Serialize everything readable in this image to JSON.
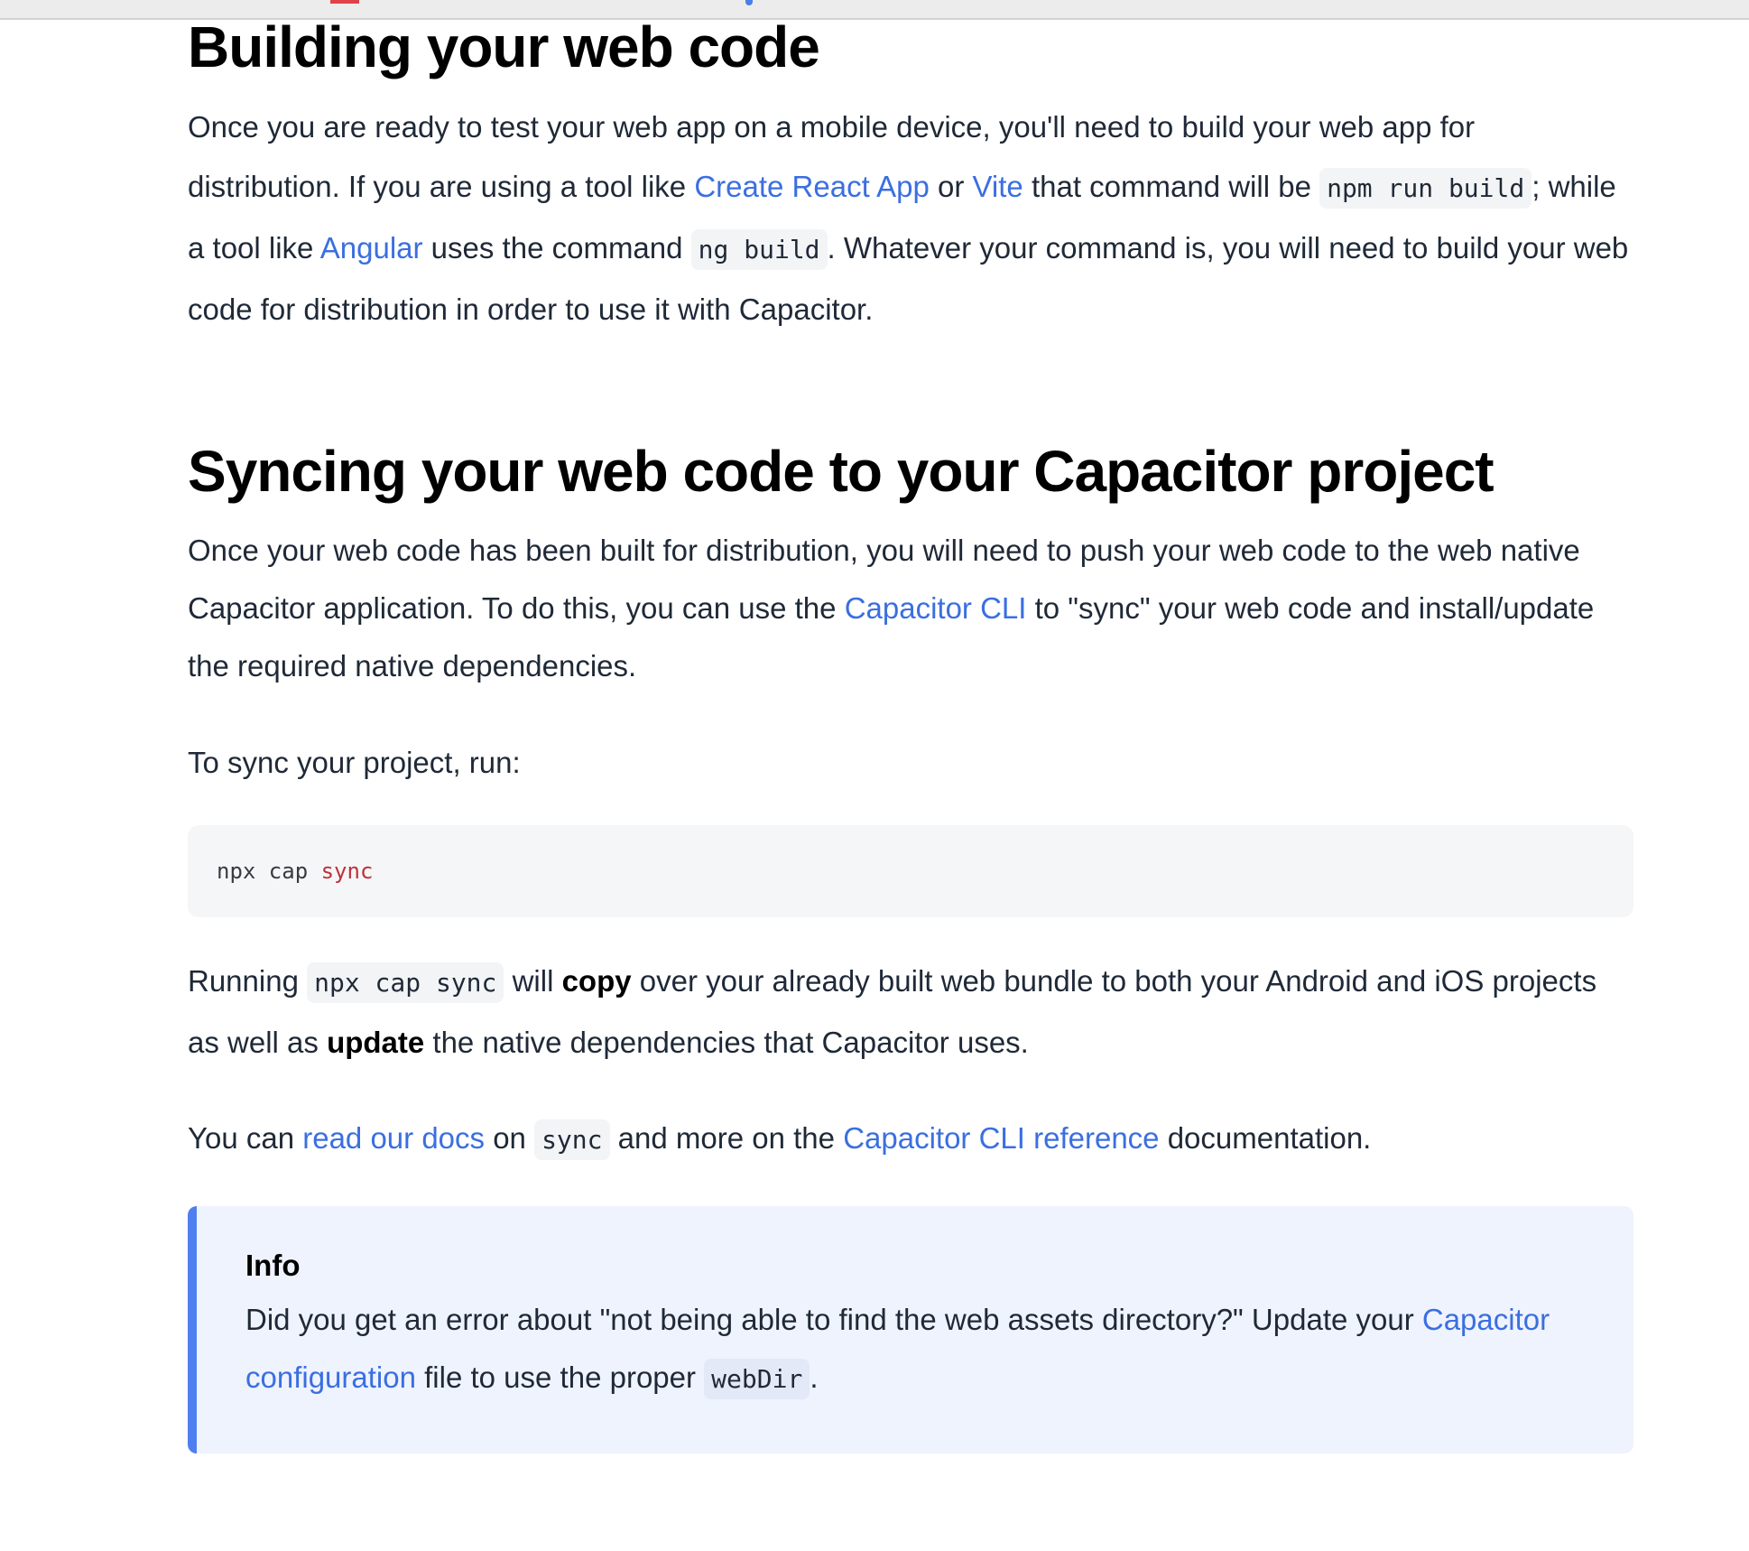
{
  "sections": {
    "building": {
      "heading": "Building your web code",
      "text_1": "Once you are ready to test your web app on a mobile device, you'll need to build your web app for distribution. If you are using a tool like ",
      "link_create_react_app": "Create React App",
      "text_2": " or ",
      "link_vite": "Vite",
      "text_3": " that command will be ",
      "code_npm_run_build": "npm run build",
      "text_4": "; while a tool like ",
      "link_angular": "Angular",
      "text_5": " uses the command ",
      "code_ng_build": "ng build",
      "text_6": ". Whatever your command is, you will need to build your web code for distribution in order to use it with Capacitor."
    },
    "syncing": {
      "heading": "Syncing your web code to your Capacitor project",
      "text_1": "Once your web code has been built for distribution, you will need to push your web code to the web native Capacitor application. To do this, you can use the ",
      "link_capacitor_cli": "Capacitor CLI",
      "text_2": " to \"sync\" your web code and install/update the required native dependencies.",
      "to_run": "To sync your project, run:",
      "code_block": {
        "part_1": "npx cap ",
        "keyword": "sync"
      },
      "running": {
        "text_1": "Running ",
        "code": "npx cap sync",
        "text_2": " will ",
        "bold_copy": "copy",
        "text_3": " over your already built web bundle to both your Android and iOS projects as well as ",
        "bold_update": "update",
        "text_4": " the native dependencies that Capacitor uses."
      },
      "you_can": {
        "text_1": "You can ",
        "link_read_docs": "read our docs",
        "text_2": " on ",
        "code_sync": "sync",
        "text_3": " and more on the ",
        "link_cli_reference": "Capacitor CLI reference",
        "text_4": " documentation."
      }
    }
  },
  "info_box": {
    "title": "Info",
    "text_1": "Did you get an error about \"not being able to find the web assets directory?\" Update your ",
    "link_config": "Capacitor configuration",
    "text_2": " file to use the proper ",
    "code_webdir": "webDir",
    "text_3": "."
  },
  "colors": {
    "link": "#3b6fe0",
    "info_accent": "#4f7ef0",
    "info_background": "#eff3fd",
    "code_keyword": "#c0303a"
  }
}
